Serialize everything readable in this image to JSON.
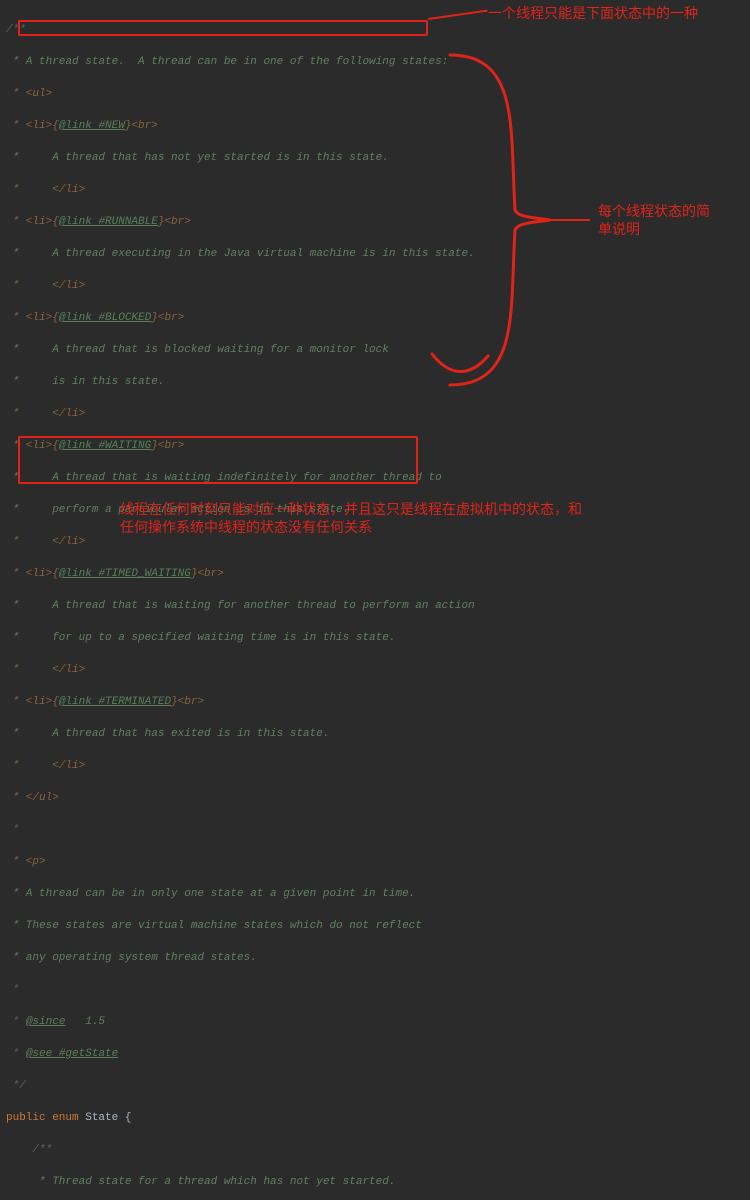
{
  "code": {
    "star": " *",
    "open": "/**",
    "close": " */",
    "l01": " * A thread state.  A thread can be in one of the following states:",
    "l02": " * <ul>",
    "l03a": " * <li>{",
    "l03b": "@link",
    "l03c": " #NEW",
    "l03d": "}<br>",
    "l04": " *     A thread that has not yet started is in this state.",
    "l05": " *     </li>",
    "l06a": " * <li>{",
    "l06b": "@link",
    "l06c": " #RUNNABLE",
    "l06d": "}<br>",
    "l07": " *     A thread executing in the Java virtual machine is in this state.",
    "l08": " *     </li>",
    "l09a": " * <li>{",
    "l09b": "@link",
    "l09c": " #BLOCKED",
    "l09d": "}<br>",
    "l10": " *     A thread that is blocked waiting for a monitor lock",
    "l11": " *     is in this state.",
    "l12": " *     </li>",
    "l13a": " * <li>{",
    "l13b": "@link",
    "l13c": " #WAITING",
    "l13d": "}<br>",
    "l14": " *     A thread that is waiting indefinitely for another thread to",
    "l15": " *     perform a particular action is in this state.",
    "l16": " *     </li>",
    "l17a": " * <li>{",
    "l17b": "@link",
    "l17c": " #TIMED_WAITING",
    "l17d": "}<br>",
    "l18": " *     A thread that is waiting for another thread to perform an action",
    "l19": " *     for up to a specified waiting time is in this state.",
    "l20": " *     </li>",
    "l21a": " * <li>{",
    "l21b": "@link",
    "l21c": " #TERMINATED",
    "l21d": "}<br>",
    "l22": " *     A thread that has exited is in this state.",
    "l23": " *     </li>",
    "l24": " * </ul>",
    "l25": " *",
    "l26": " * <p>",
    "l27": " * A thread can be in only one state at a given point in time.",
    "l28": " * These states are virtual machine states which do not reflect",
    "l29": " * any operating system thread states.",
    "l30": " *",
    "l31a": " * ",
    "l31b": "@since",
    "l31c": "   1.5",
    "l32a": " * ",
    "l32b": "@see",
    "l32c": " #getState",
    "l33": " */",
    "l34a": "public",
    "l34b": " enum",
    "l34c": " State ",
    "l34d": "{",
    "l35": "    /**",
    "l36": "     * Thread state for a thread which has not yet started."
  },
  "annotations": {
    "top": "一个线程只能是下面状态中的一种",
    "mid1": "每个线程状态的简",
    "mid2": "单说明",
    "bot1": "线程在任何时刻只能对应一种状态，并且这只是线程在虚拟机中的状态，和",
    "bot2": "任何操作系统中线程的状态没有任何关系"
  }
}
